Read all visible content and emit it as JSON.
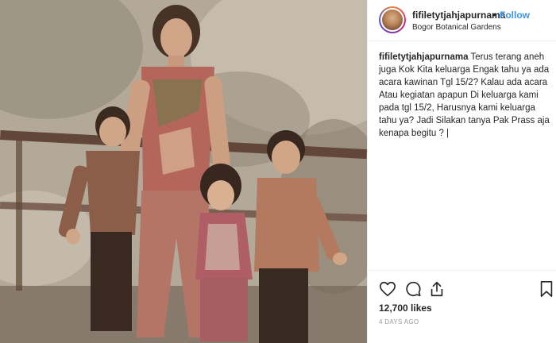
{
  "post": {
    "username": "fifiletytjahjapurnama",
    "separator": "•",
    "follow_label": "Follow",
    "location": "Bogor Botanical Gardens",
    "caption_username": "fifiletytjahjapurnama",
    "caption_text": "Terus terang aneh juga Kok Kita keluarga Engak tahu ya ada acara kawinan Tgl 15/2? Kalau ada acara Atau kegiatan apapun Di keluarga kami pada tgl 15/2, Harusnya kami keluarga tahu ya? Jadi Silakan tanya Pak Prass aja kenapa begitu ? |",
    "likes": "12,700 likes",
    "time": "4 DAYS AGO"
  },
  "icons": {
    "like": "heart-icon",
    "comment": "comment-icon",
    "share": "share-icon",
    "save": "bookmark-icon"
  },
  "colors": {
    "accent": "#3897f0",
    "text": "#262626",
    "muted": "#999999",
    "border": "#efefef"
  }
}
